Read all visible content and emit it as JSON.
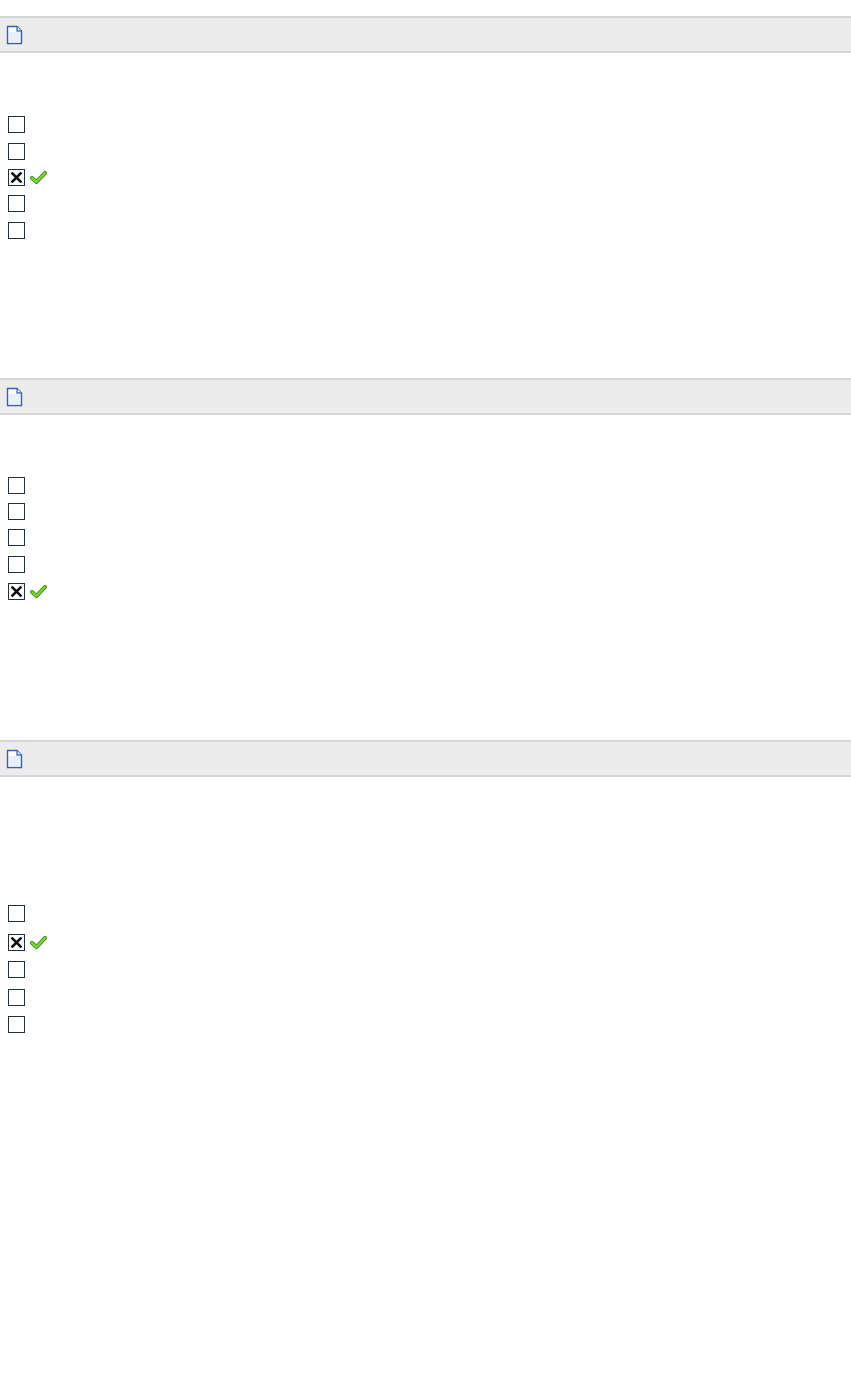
{
  "questions": [
    {
      "title": "",
      "icon": "document-icon",
      "options": [
        {
          "label": "",
          "checked": false,
          "correct": false
        },
        {
          "label": "",
          "checked": false,
          "correct": false
        },
        {
          "label": "",
          "checked": true,
          "correct": true
        },
        {
          "label": "",
          "checked": false,
          "correct": false
        },
        {
          "label": "",
          "checked": false,
          "correct": false
        }
      ]
    },
    {
      "title": "",
      "icon": "document-icon",
      "options": [
        {
          "label": "",
          "checked": false,
          "correct": false
        },
        {
          "label": "",
          "checked": false,
          "correct": false
        },
        {
          "label": "",
          "checked": false,
          "correct": false
        },
        {
          "label": "",
          "checked": false,
          "correct": false
        },
        {
          "label": "",
          "checked": true,
          "correct": true
        }
      ]
    },
    {
      "title": "",
      "icon": "document-icon",
      "options": [
        {
          "label": "",
          "checked": false,
          "correct": false
        },
        {
          "label": "",
          "checked": true,
          "correct": true
        },
        {
          "label": "",
          "checked": false,
          "correct": false
        },
        {
          "label": "",
          "checked": false,
          "correct": false
        },
        {
          "label": "",
          "checked": false,
          "correct": false
        }
      ]
    }
  ],
  "colors": {
    "header_bg": "#ececec",
    "header_border": "#d6d6d6",
    "checkbox_border": "#1f2f45",
    "check_green": "#5ab52a",
    "doc_icon_blue": "#3b5fa8"
  }
}
